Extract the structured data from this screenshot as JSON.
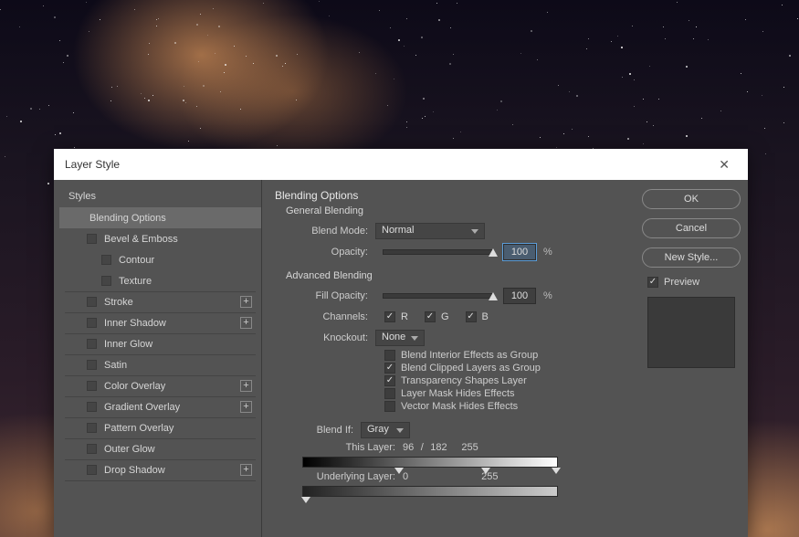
{
  "dialog": {
    "title": "Layer Style"
  },
  "sidebar": {
    "header": "Styles",
    "items": [
      {
        "label": "Blending Options",
        "selected": true,
        "checkbox": false,
        "indent": 0
      },
      {
        "label": "Bevel & Emboss",
        "checkbox": true,
        "indent": 1
      },
      {
        "label": "Contour",
        "checkbox": true,
        "indent": 2
      },
      {
        "label": "Texture",
        "checkbox": true,
        "indent": 2,
        "divider": true
      },
      {
        "label": "Stroke",
        "checkbox": true,
        "indent": 1,
        "plus": true,
        "divider": true
      },
      {
        "label": "Inner Shadow",
        "checkbox": true,
        "indent": 1,
        "plus": true,
        "divider": true
      },
      {
        "label": "Inner Glow",
        "checkbox": true,
        "indent": 1,
        "divider": true
      },
      {
        "label": "Satin",
        "checkbox": true,
        "indent": 1,
        "divider": true
      },
      {
        "label": "Color Overlay",
        "checkbox": true,
        "indent": 1,
        "plus": true,
        "divider": true
      },
      {
        "label": "Gradient Overlay",
        "checkbox": true,
        "indent": 1,
        "plus": true,
        "divider": true
      },
      {
        "label": "Pattern Overlay",
        "checkbox": true,
        "indent": 1,
        "divider": true
      },
      {
        "label": "Outer Glow",
        "checkbox": true,
        "indent": 1,
        "divider": true
      },
      {
        "label": "Drop Shadow",
        "checkbox": true,
        "indent": 1,
        "plus": true,
        "divider": true
      }
    ]
  },
  "main": {
    "title": "Blending Options",
    "general": {
      "heading": "General Blending",
      "blend_mode_label": "Blend Mode:",
      "blend_mode_value": "Normal",
      "opacity_label": "Opacity:",
      "opacity_value": "100",
      "percent": "%"
    },
    "advanced": {
      "heading": "Advanced Blending",
      "fill_label": "Fill Opacity:",
      "fill_value": "100",
      "channels_label": "Channels:",
      "channels": {
        "R": true,
        "G": true,
        "B": true
      },
      "knockout_label": "Knockout:",
      "knockout_value": "None",
      "checks": [
        {
          "label": "Blend Interior Effects as Group",
          "on": false
        },
        {
          "label": "Blend Clipped Layers as Group",
          "on": true
        },
        {
          "label": "Transparency Shapes Layer",
          "on": true
        },
        {
          "label": "Layer Mask Hides Effects",
          "on": false
        },
        {
          "label": "Vector Mask Hides Effects",
          "on": false
        }
      ]
    },
    "blendif": {
      "label": "Blend If:",
      "value": "Gray",
      "this_layer_label": "This Layer:",
      "this_layer_low": "96",
      "this_layer_sep": "/",
      "this_layer_mid": "182",
      "this_layer_high": "255",
      "underlying_label": "Underlying Layer:",
      "underlying_low": "0",
      "underlying_high": "255"
    }
  },
  "buttons": {
    "ok": "OK",
    "cancel": "Cancel",
    "new_style": "New Style...",
    "preview_label": "Preview"
  }
}
